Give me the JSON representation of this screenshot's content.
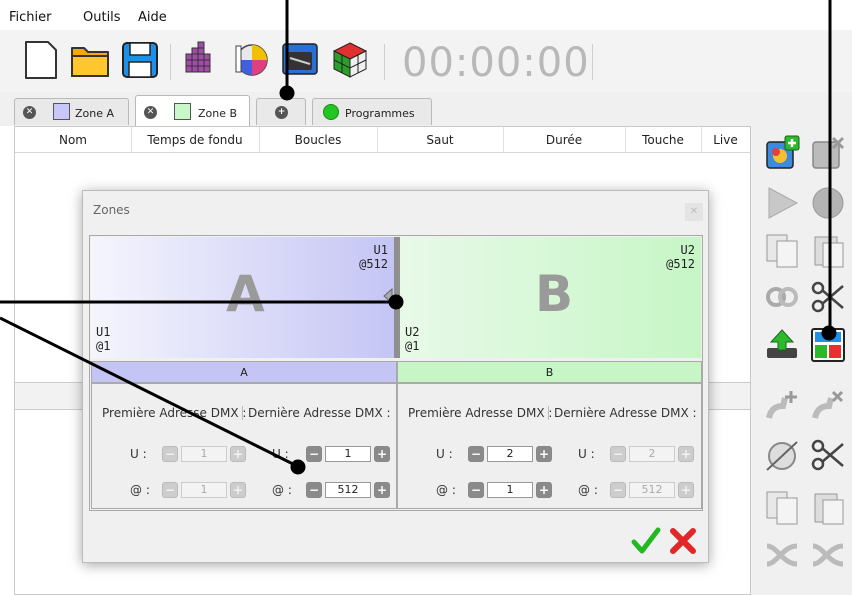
{
  "menu": {
    "items": [
      "Fichier",
      "Outils",
      "Aide"
    ]
  },
  "toolbar": {
    "timer": "00:00:00",
    "icons": [
      "new-file-icon",
      "open-folder-icon",
      "save-icon",
      "grid-icon",
      "color-wheel-icon",
      "chip-icon",
      "rubik-cube-icon"
    ]
  },
  "tabs": [
    {
      "label": "Zone A",
      "swatch": "#c8c8f8"
    },
    {
      "label": "Zone B",
      "swatch": "#c8f8c8"
    },
    {
      "label": "Programmes"
    }
  ],
  "table": {
    "columns": [
      "Nom",
      "Temps de fondu",
      "Boucles",
      "Saut",
      "Durée",
      "Touche",
      "Live"
    ]
  },
  "dialog": {
    "title": "Zones",
    "zoneA": {
      "letter": "A",
      "top_u": "U1",
      "top_at": "@512",
      "bottom_u": "U1",
      "bottom_at": "@1",
      "header": "A",
      "color": "#c5c5f5"
    },
    "zoneB": {
      "letter": "B",
      "top_u": "U2",
      "top_at": "@512",
      "bottom_u": "U2",
      "bottom_at": "@1",
      "header": "B",
      "color": "#c6f6c6"
    },
    "labels": {
      "first": "Première Adresse DMX :",
      "last": "Dernière Adresse DMX :",
      "u": "U :",
      "at": "@ :"
    },
    "values": {
      "a_first_u": "1",
      "a_first_at": "1",
      "a_last_u": "1",
      "a_last_at": "512",
      "b_first_u": "2",
      "b_first_at": "1",
      "b_last_u": "2",
      "b_last_at": "512"
    }
  },
  "colors": {
    "accent_green": "#2ecc2e",
    "accent_red": "#e83030",
    "blue": "#1e90e8"
  }
}
